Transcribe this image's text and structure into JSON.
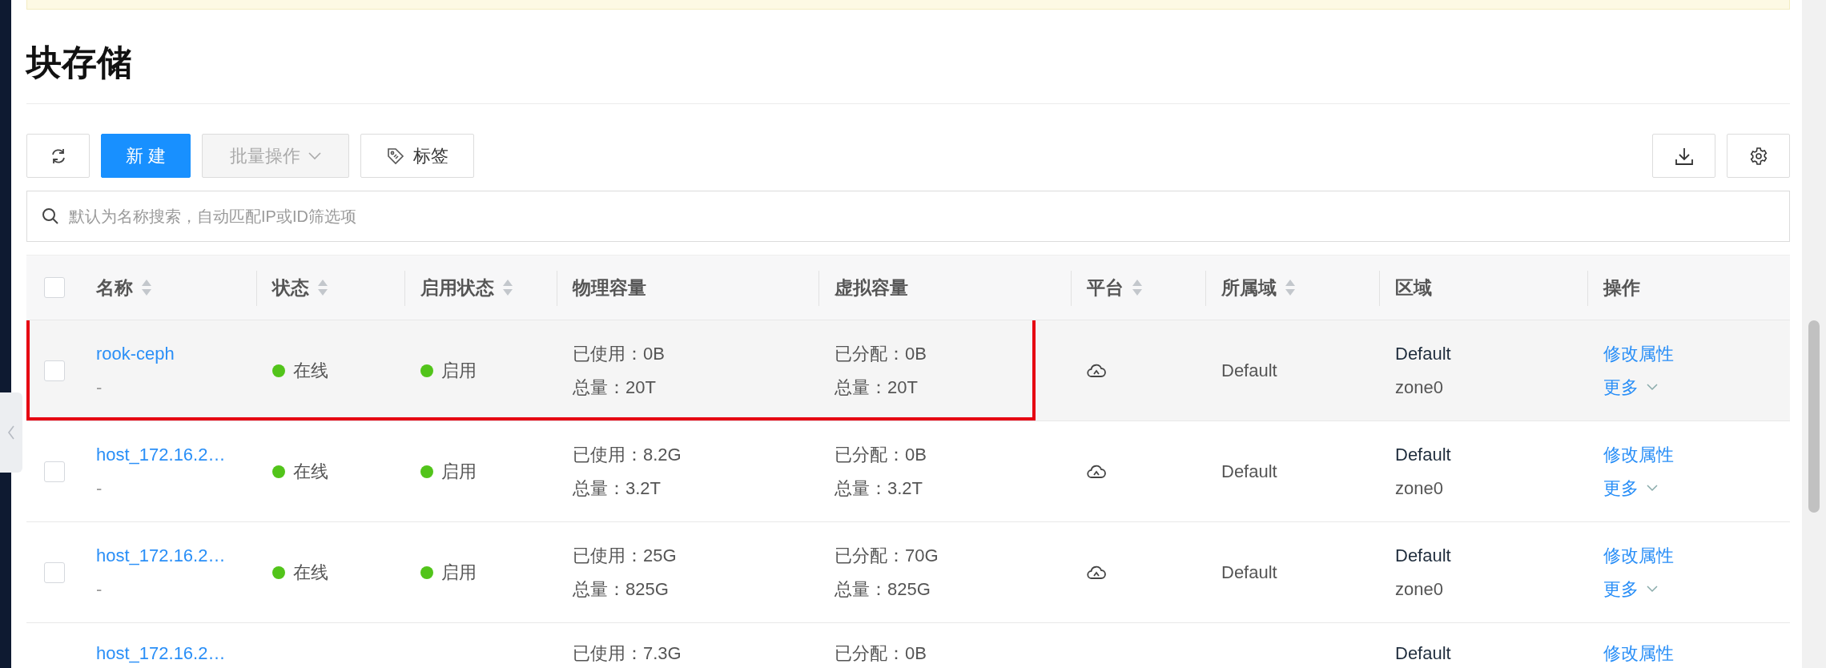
{
  "title": "块存储",
  "toolbar": {
    "create": "新 建",
    "batch": {
      "label": "批量操作",
      "disabled": true
    },
    "tags": "标签"
  },
  "search": {
    "placeholder": "默认为名称搜索，自动匹配IP或ID筛选项"
  },
  "table": {
    "select_all": {
      "checked": false
    },
    "columns": [
      {
        "label": "名称",
        "sortable": true
      },
      {
        "label": "状态",
        "sortable": true
      },
      {
        "label": "启用状态",
        "sortable": true
      },
      {
        "label": "物理容量",
        "sortable": false
      },
      {
        "label": "虚拟容量",
        "sortable": false
      },
      {
        "label": "平台",
        "sortable": true
      },
      {
        "label": "所属域",
        "sortable": true
      },
      {
        "label": "区域",
        "sortable": false
      },
      {
        "label": "操作",
        "sortable": false
      }
    ],
    "rows": [
      {
        "checked": false,
        "highlighted": true,
        "annotated": true,
        "name": "rook-ceph",
        "description": "-",
        "status": {
          "label": "在线",
          "color": "#52c41a"
        },
        "enabled": {
          "label": "启用",
          "color": "#52c41a"
        },
        "physical": [
          "已使用：0B",
          "总量：20T"
        ],
        "virtual": [
          "已分配：0B",
          "总量：20T"
        ],
        "cloud_icon": true,
        "domain": "Default",
        "region": [
          "Default",
          "zone0"
        ],
        "actions": [
          "修改属性",
          "更多"
        ]
      },
      {
        "checked": false,
        "highlighted": false,
        "annotated": false,
        "name": "host_172.16.2…",
        "description": "-",
        "status": {
          "label": "在线",
          "color": "#52c41a"
        },
        "enabled": {
          "label": "启用",
          "color": "#52c41a"
        },
        "physical": [
          "已使用：8.2G",
          "总量：3.2T"
        ],
        "virtual": [
          "已分配：0B",
          "总量：3.2T"
        ],
        "cloud_icon": true,
        "domain": "Default",
        "region": [
          "Default",
          "zone0"
        ],
        "actions": [
          "修改属性",
          "更多"
        ]
      },
      {
        "checked": false,
        "highlighted": false,
        "annotated": false,
        "name": "host_172.16.2…",
        "description": "-",
        "status": {
          "label": "在线",
          "color": "#52c41a"
        },
        "enabled": {
          "label": "启用",
          "color": "#52c41a"
        },
        "physical": [
          "已使用：25G",
          "总量：825G"
        ],
        "virtual": [
          "已分配：70G",
          "总量：825G"
        ],
        "cloud_icon": true,
        "domain": "Default",
        "region": [
          "Default",
          "zone0"
        ],
        "actions": [
          "修改属性",
          "更多"
        ]
      },
      {
        "highlighted": false,
        "annotated": false,
        "name": "host_172.16.2…",
        "physical": [
          "已使用：7.3G"
        ],
        "virtual": [
          "已分配：0B"
        ],
        "cloud_icon": false,
        "region": [
          "Default"
        ],
        "actions": [
          "修改属性"
        ]
      }
    ]
  }
}
